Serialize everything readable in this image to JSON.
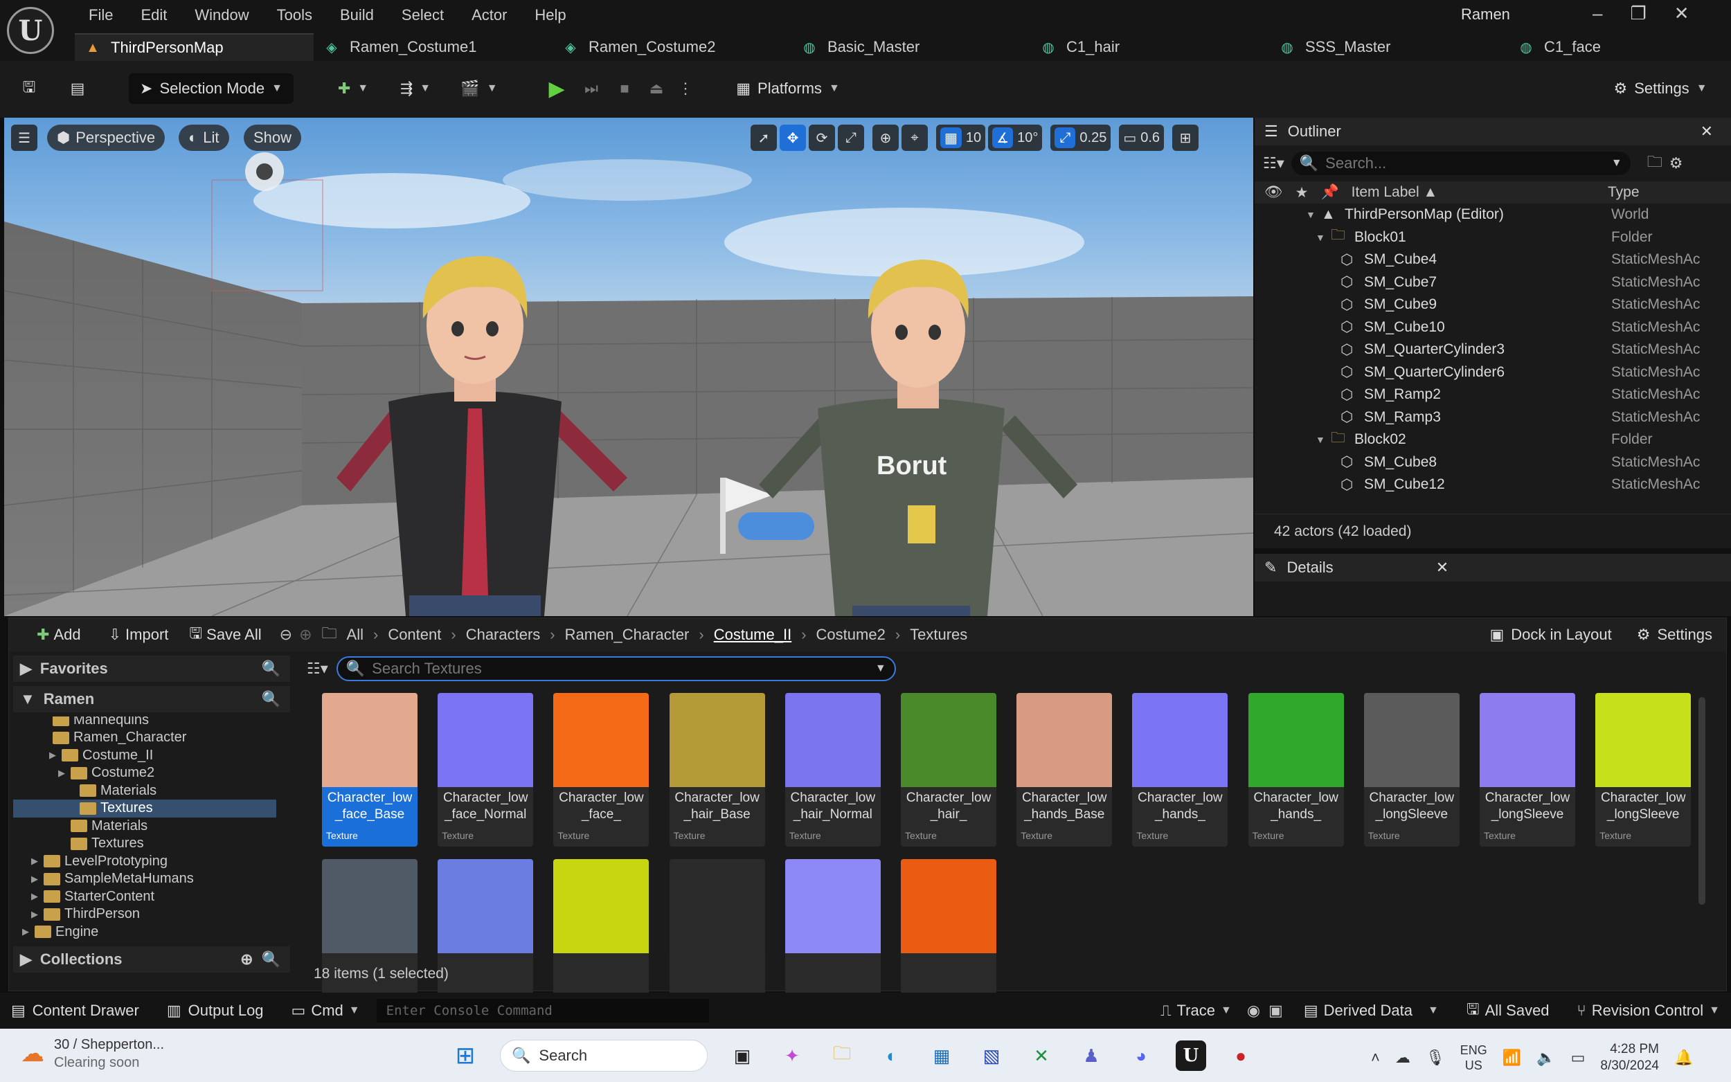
{
  "app": {
    "logo": "U",
    "menu": [
      "File",
      "Edit",
      "Window",
      "Tools",
      "Build",
      "Select",
      "Actor",
      "Help"
    ],
    "project": "Ramen",
    "tabs": [
      {
        "label": "ThirdPersonMap",
        "icon": "level-icon",
        "active": true
      },
      {
        "label": "Ramen_Costume1",
        "icon": "mesh-icon"
      },
      {
        "label": "Ramen_Costume2",
        "icon": "mesh-icon"
      },
      {
        "label": "Basic_Master",
        "icon": "material-icon"
      },
      {
        "label": "C1_hair",
        "icon": "material-icon"
      },
      {
        "label": "SSS_Master",
        "icon": "material-icon"
      },
      {
        "label": "C1_face",
        "icon": "material-icon"
      }
    ]
  },
  "toolbar": {
    "selection_mode": "Selection Mode",
    "platforms": "Platforms",
    "settings": "Settings"
  },
  "viewport": {
    "perspective": "Perspective",
    "lit": "Lit",
    "show": "Show",
    "grid_snap": "10",
    "rot_snap": "10°",
    "scale_snap": "0.25",
    "cam_speed": "0.6",
    "shirt_text": "Borut"
  },
  "outliner": {
    "title": "Outliner",
    "search_placeholder": "Search...",
    "col_label": "Item Label ▲",
    "col_type": "Type",
    "rows": [
      {
        "label": "ThirdPersonMap (Editor)",
        "type": "World",
        "indent": 0,
        "kind": "world"
      },
      {
        "label": "Block01",
        "type": "Folder",
        "indent": 1,
        "kind": "folder"
      },
      {
        "label": "SM_Cube4",
        "type": "StaticMeshAc",
        "indent": 2,
        "kind": "mesh"
      },
      {
        "label": "SM_Cube7",
        "type": "StaticMeshAc",
        "indent": 2,
        "kind": "mesh"
      },
      {
        "label": "SM_Cube9",
        "type": "StaticMeshAc",
        "indent": 2,
        "kind": "mesh"
      },
      {
        "label": "SM_Cube10",
        "type": "StaticMeshAc",
        "indent": 2,
        "kind": "mesh"
      },
      {
        "label": "SM_QuarterCylinder3",
        "type": "StaticMeshAc",
        "indent": 2,
        "kind": "mesh"
      },
      {
        "label": "SM_QuarterCylinder6",
        "type": "StaticMeshAc",
        "indent": 2,
        "kind": "mesh"
      },
      {
        "label": "SM_Ramp2",
        "type": "StaticMeshAc",
        "indent": 2,
        "kind": "mesh"
      },
      {
        "label": "SM_Ramp3",
        "type": "StaticMeshAc",
        "indent": 2,
        "kind": "mesh"
      },
      {
        "label": "Block02",
        "type": "Folder",
        "indent": 1,
        "kind": "folder"
      },
      {
        "label": "SM_Cube8",
        "type": "StaticMeshAc",
        "indent": 2,
        "kind": "mesh"
      },
      {
        "label": "SM_Cube12",
        "type": "StaticMeshAc",
        "indent": 2,
        "kind": "mesh"
      }
    ],
    "footer": "42 actors (42 loaded)"
  },
  "details": {
    "title": "Details"
  },
  "content": {
    "add": "Add",
    "import": "Import",
    "save_all": "Save All",
    "breadcrumbs": [
      "All",
      "Content",
      "Characters",
      "Ramen_Character",
      "Costume_II",
      "Costume2",
      "Textures"
    ],
    "dock": "Dock in Layout",
    "settings": "Settings",
    "favorites": "Favorites",
    "root": "Ramen",
    "search_placeholder": "Search Textures",
    "tree": [
      {
        "label": "Mannequins",
        "indent": 3,
        "partial": true
      },
      {
        "label": "Ramen_Character",
        "indent": 3
      },
      {
        "label": "Costume_II",
        "indent": 4
      },
      {
        "label": "Costume2",
        "indent": 5
      },
      {
        "label": "Materials",
        "indent": 6
      },
      {
        "label": "Textures",
        "indent": 6,
        "selected": true
      },
      {
        "label": "Materials",
        "indent": 5
      },
      {
        "label": "Textures",
        "indent": 5
      },
      {
        "label": "LevelPrototyping",
        "indent": 2
      },
      {
        "label": "SampleMetaHumans",
        "indent": 2
      },
      {
        "label": "StarterContent",
        "indent": 2
      },
      {
        "label": "ThirdPerson",
        "indent": 2
      },
      {
        "label": "Engine",
        "indent": 1
      }
    ],
    "collections": "Collections",
    "assets": [
      {
        "name": "Character_low\n_face_Base",
        "type": "Texture",
        "color": "#e3a98e",
        "selected": true
      },
      {
        "name": "Character_low\n_face_Normal",
        "type": "Texture",
        "color": "#7a73f2"
      },
      {
        "name": "Character_low\n_face_",
        "type": "Texture",
        "color": "#f46a17"
      },
      {
        "name": "Character_low\n_hair_Base",
        "type": "Texture",
        "color": "#b59a38"
      },
      {
        "name": "Character_low\n_hair_Normal",
        "type": "Texture",
        "color": "#7a75ef"
      },
      {
        "name": "Character_low\n_hair_",
        "type": "Texture",
        "color": "#4a8a2a"
      },
      {
        "name": "Character_low\n_hands_Base",
        "type": "Texture",
        "color": "#d69b82"
      },
      {
        "name": "Character_low\n_hands_",
        "type": "Texture",
        "color": "#7b74f3"
      },
      {
        "name": "Character_low\n_hands_",
        "type": "Texture",
        "color": "#2fa82c"
      },
      {
        "name": "Character_low\n_longSleeve",
        "type": "Texture",
        "color": "#5b5b5b"
      },
      {
        "name": "Character_low\n_longSleeve",
        "type": "Texture",
        "color": "#8d7cf0"
      },
      {
        "name": "Character_low\n_longSleeve",
        "type": "Texture",
        "color": "#c6e11b"
      },
      {
        "name": "",
        "type": "",
        "color": "#505a66"
      },
      {
        "name": "",
        "type": "",
        "color": "#6b7de0"
      },
      {
        "name": "",
        "type": "",
        "color": "#c7d610"
      },
      {
        "name": "",
        "type": "",
        "color": "#2b2b2b"
      },
      {
        "name": "",
        "type": "",
        "color": "#8c88f5"
      },
      {
        "name": "",
        "type": "",
        "color": "#ea5c12"
      }
    ],
    "count": "18 items (1 selected)"
  },
  "status": {
    "content_drawer": "Content Drawer",
    "output_log": "Output Log",
    "cmd": "Cmd",
    "console_placeholder": "Enter Console Command",
    "trace": "Trace",
    "derived_data": "Derived Data",
    "all_saved": "All Saved",
    "revision": "Revision Control"
  },
  "taskbar": {
    "weather_line1": "30 / Shepperton...",
    "weather_line2": "Clearing soon",
    "search": "Search",
    "lang1": "ENG",
    "lang2": "US",
    "time": "4:28 PM",
    "date": "8/30/2024"
  }
}
